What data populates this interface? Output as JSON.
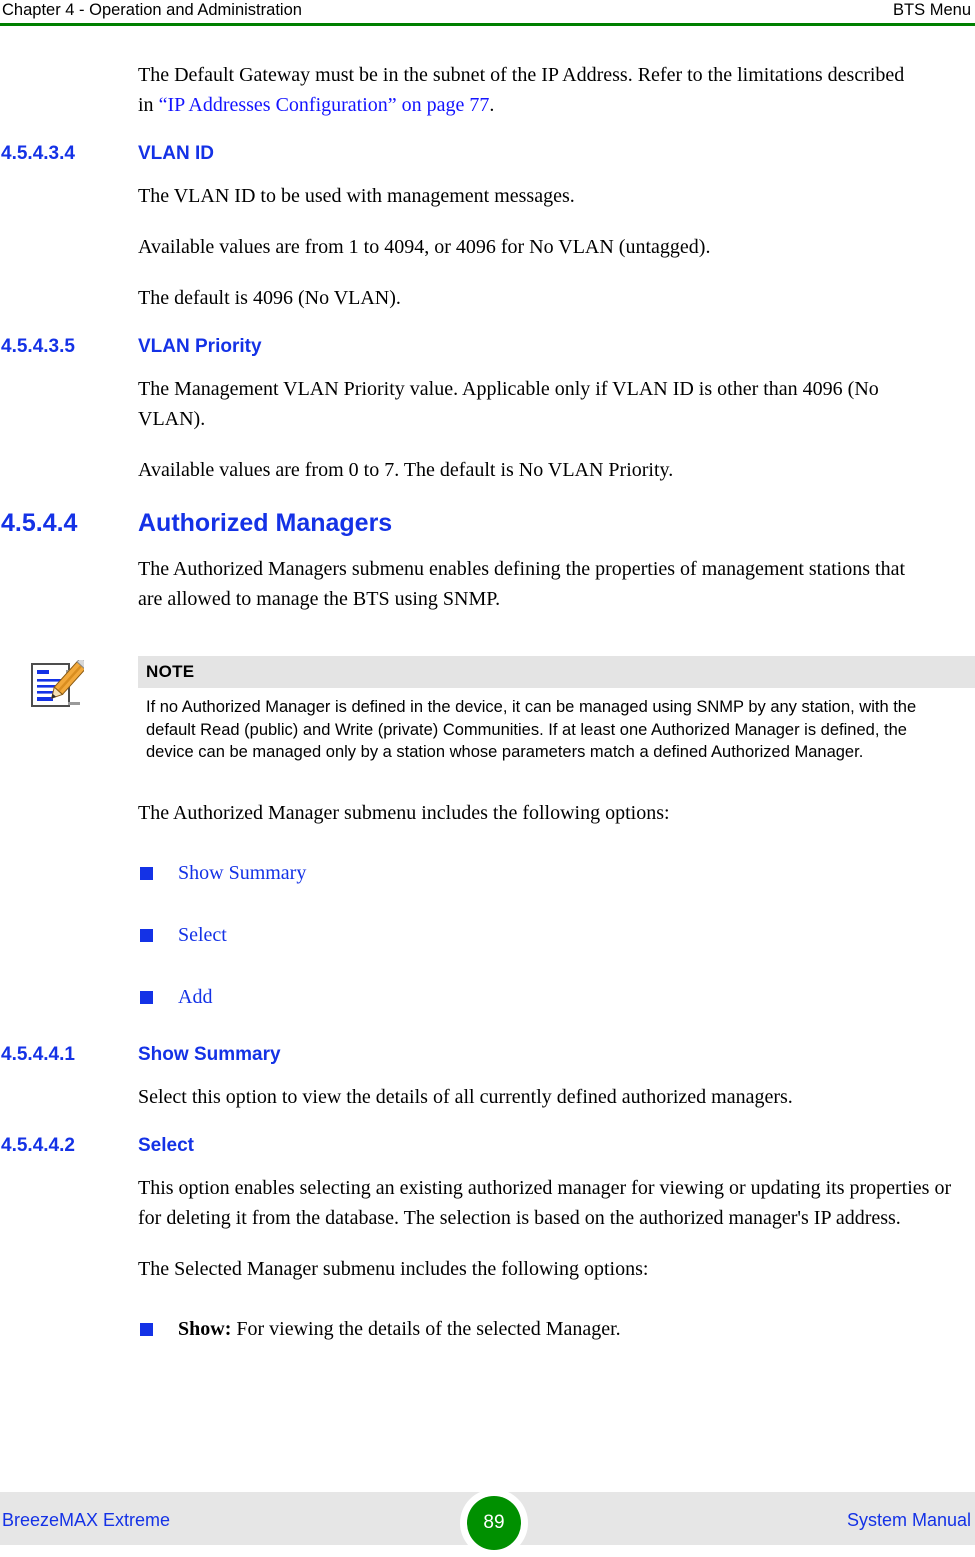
{
  "header": {
    "left": "Chapter 4 - Operation and Administration",
    "right": "BTS Menu",
    "rule_color": "#008000"
  },
  "intro": {
    "line_1": "The Default Gateway must be in the subnet of the IP Address. Refer to the",
    "line_2_prefix": "limitations described in ",
    "line_2_link": "“IP Addresses Configuration” on page 77",
    "line_2_suffix": "."
  },
  "sections": {
    "vlan_id": {
      "number": "4.5.4.3.4",
      "title": "VLAN ID",
      "p1": "The VLAN ID to be used with management messages.",
      "p2": "Available values are from 1 to 4094, or 4096 for No VLAN (untagged).",
      "p3": "The default is 4096 (No VLAN)."
    },
    "vlan_priority": {
      "number": "4.5.4.3.5",
      "title": "VLAN Priority",
      "p1": "The Management VLAN Priority value. Applicable only if VLAN ID is other than 4096 (No VLAN).",
      "p2": "Available values are from 0 to 7. The default is No VLAN Priority."
    },
    "authorized_managers": {
      "number": "4.5.4.4",
      "title": "Authorized Managers",
      "p1": "The Authorized Managers submenu enables defining the properties of management stations that are allowed to manage the BTS using SNMP.",
      "p2": "The Authorized Manager submenu includes the following options:"
    },
    "show_summary": {
      "number": "4.5.4.4.1",
      "title": "Show Summary",
      "p1": "Select this option to view the details of all currently defined authorized managers."
    },
    "select": {
      "number": "4.5.4.4.2",
      "title": "Select",
      "p1": "This option enables selecting an existing authorized manager for viewing or updating its properties or for deleting it from the database. The selection is based on the authorized manager's IP address.",
      "p2": "The Selected Manager submenu includes the following options:"
    }
  },
  "note": {
    "icon": "note-pencil-icon",
    "title": "NOTE",
    "text": "If no Authorized Manager is defined in the device, it can be managed using SNMP by any station, with the default Read (public) and Write (private) Communities. If at least one Authorized Manager is defined, the device can be managed only by a station whose parameters match a defined Authorized Manager.",
    "title_bg": "#e4e4e4"
  },
  "options_list": [
    {
      "label": "Show Summary",
      "link": true
    },
    {
      "label": "Select",
      "link": true
    },
    {
      "label": "Add",
      "link": true
    }
  ],
  "selected_manager_list": [
    {
      "bold": "Show:",
      "rest": " For viewing the details of the selected Manager.",
      "link": false
    }
  ],
  "footer": {
    "left": "BreezeMAX Extreme",
    "right": "System Manual",
    "page_number": "89",
    "badge_color": "#009000",
    "band_color": "#e6e6e6",
    "text_color": "#1432e6"
  }
}
